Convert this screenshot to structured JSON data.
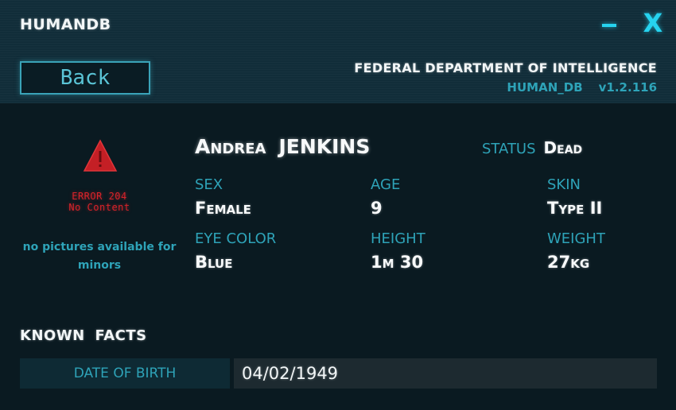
{
  "window": {
    "title": "HUMANDB",
    "minimize_label": "",
    "close_label": "X"
  },
  "header": {
    "back_label": "Back",
    "agency": "FEDERAL DEPARTMENT OF INTELLIGENCE",
    "db_name": "HUMAN_DB",
    "version": "v1.2.116"
  },
  "photo": {
    "icon": "warning-triangle-icon",
    "error_line1": "ERROR 204",
    "error_line2": "No Content",
    "note": "no pictures available for minors"
  },
  "person": {
    "first_name": "Andrea",
    "last_name": "JENKINS",
    "status_label": "STATUS",
    "status_value": "Dead",
    "fields": [
      {
        "label": "SEX",
        "value": "Female"
      },
      {
        "label": "AGE",
        "value": "9"
      },
      {
        "label": "SKIN",
        "value": "Type II"
      },
      {
        "label": "EYE COLOR",
        "value": "Blue"
      },
      {
        "label": "HEIGHT",
        "value": "1m 30"
      },
      {
        "label": "WEIGHT",
        "value": "27kg"
      }
    ]
  },
  "facts": {
    "title": "KNOWN FACTS",
    "rows": [
      {
        "label": "DATE OF BIRTH",
        "value": "04/02/1949"
      }
    ]
  },
  "colors": {
    "accent": "#26d3ef",
    "label": "#2ea3b8",
    "error": "#d9232a",
    "background": "#0a1a21"
  }
}
